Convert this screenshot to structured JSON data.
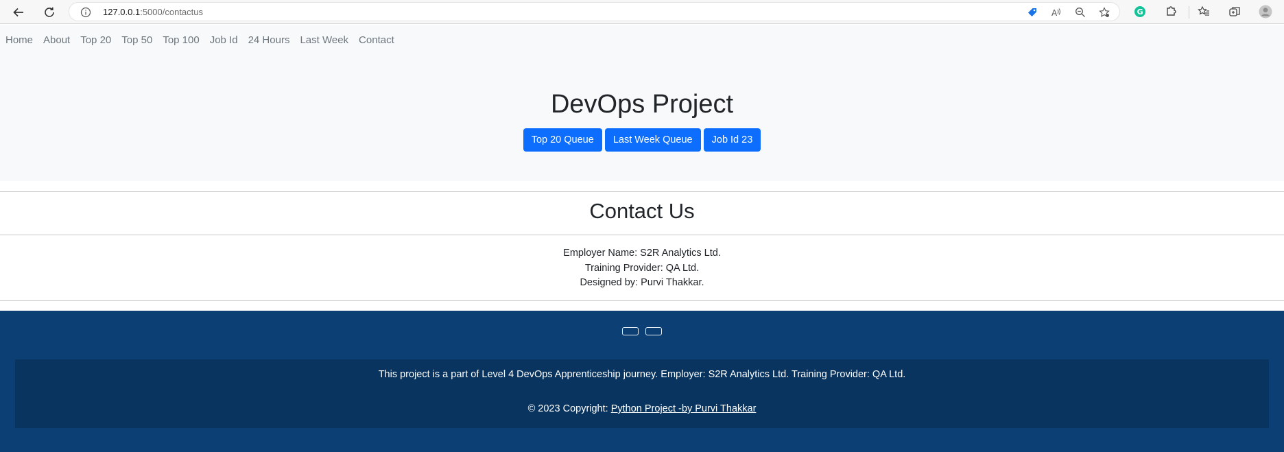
{
  "browser": {
    "url_host": "127.0.0.1",
    "url_path": ":5000/contactus",
    "back_icon": "back-arrow-icon",
    "reload_icon": "reload-icon",
    "site_info_icon": "info-icon"
  },
  "nav": {
    "items": [
      "Home",
      "About",
      "Top 20",
      "Top 50",
      "Top 100",
      "Job Id",
      "24 Hours",
      "Last Week",
      "Contact"
    ]
  },
  "hero": {
    "title": "DevOps Project",
    "buttons": [
      "Top 20 Queue",
      "Last Week Queue",
      "Job Id 23"
    ],
    "button_color": "#0d6efd"
  },
  "contact": {
    "title": "Contact Us",
    "lines": [
      "Employer Name: S2R Analytics Ltd.",
      "Training Provider: QA Ltd.",
      "Designed by: Purvi Thakkar."
    ]
  },
  "footer": {
    "text": "This project is a part of Level 4 DevOps Apprenticeship journey. Employer: S2R Analytics Ltd. Training Provider: QA Ltd.",
    "copyright_prefix": "© 2023 Copyright: ",
    "copyright_link": "Python Project -by Purvi Thakkar",
    "background_color": "#0c3f73",
    "inner_color": "#08345f"
  }
}
